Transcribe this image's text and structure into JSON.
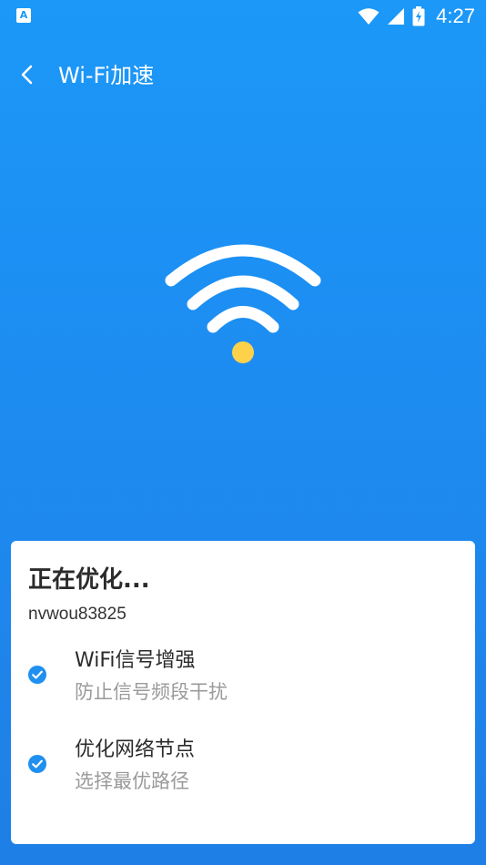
{
  "status_bar": {
    "app_icon_label": "A",
    "time": "4:27",
    "icons": [
      "wifi-icon",
      "cell-signal-icon",
      "battery-icon"
    ]
  },
  "app_bar": {
    "title": "Wi-Fi加速",
    "back_icon": "back-arrow-icon"
  },
  "hero": {
    "icon": "wifi-icon",
    "dot_color": "#fdd24a"
  },
  "card": {
    "title": "正在优化...",
    "ssid": "nvwou83825",
    "items": [
      {
        "title": "WiFi信号增强",
        "subtitle": "防止信号频段干扰",
        "icon": "check-circle-icon"
      },
      {
        "title": "优化网络节点",
        "subtitle": "选择最优路径",
        "icon": "check-circle-icon"
      }
    ]
  },
  "colors": {
    "background_top": "#1b98f8",
    "background_bottom": "#1e7fe6",
    "check": "#1f8ff0"
  }
}
